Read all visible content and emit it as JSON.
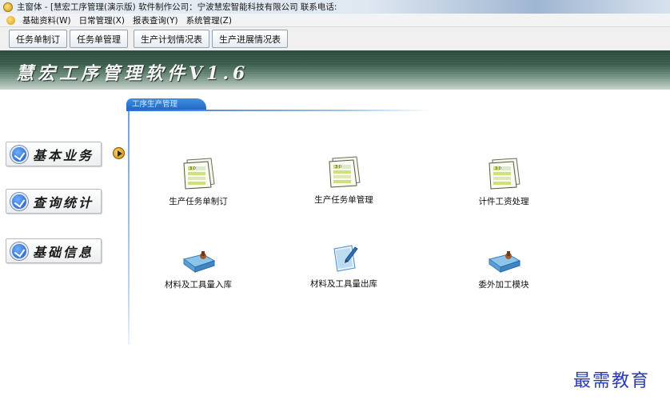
{
  "window": {
    "title": "主窗体 - [慧宏工序管理(演示版) 软件制作公司：宁波慧宏智能科技有限公司 联系电话:"
  },
  "menu": {
    "items": [
      "基础资料(W)",
      "日常管理(X)",
      "报表查询(Y)",
      "系统管理(Z)"
    ]
  },
  "toolbar": {
    "buttons": [
      "任务单制订",
      "任务单管理",
      "生产计划情况表",
      "生产进展情况表"
    ]
  },
  "banner": {
    "title": "慧宏工序管理软件V1.6"
  },
  "section": {
    "tab_label": "工序生产管理"
  },
  "nav": {
    "items": [
      "基本业务",
      "查询统计",
      "基础信息"
    ]
  },
  "modules": {
    "items": [
      "生产任务单制订",
      "生产任务单管理",
      "计件工资处理",
      "材料及工具量入库",
      "材料及工具量出库",
      "委外加工模块"
    ]
  },
  "watermark": {
    "text": "最需教育"
  },
  "colors": {
    "banner_dark": "#2c4a3c",
    "tab_blue": "#1f66c2",
    "watermark": "#2a3cae"
  }
}
